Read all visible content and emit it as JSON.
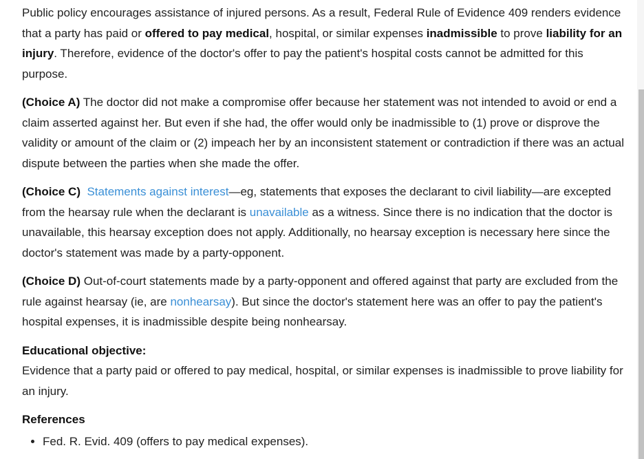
{
  "intro": {
    "t1": "Public policy encourages assistance of injured persons.  As a result, Federal Rule of Evidence 409 renders evidence that a party has paid or ",
    "b1": "offered to pay medical",
    "t2": ", hospital, or similar expenses ",
    "b2": "inadmissible",
    "t3": " to prove ",
    "b3": "liability for an injury",
    "t4": ".  Therefore, evidence of the doctor's offer to pay the patient's hospital costs cannot be admitted for this purpose."
  },
  "choice_a": {
    "label": "(Choice A)",
    "text": "  The doctor did not make a compromise offer because her statement was not intended to avoid or end a claim asserted against her.  But even if she had, the offer would only be inadmissible to (1) prove or disprove the validity or amount of the claim or (2) impeach her by an inconsistent statement or contradiction if there was an actual dispute between the parties when she made the offer."
  },
  "choice_c": {
    "label": "(Choice C)",
    "link1": "Statements against interest",
    "t1": "—eg, statements that exposes the declarant to civil liability—are excepted from the hearsay rule when the declarant is ",
    "link2": "unavailable",
    "t2": " as a witness.  Since there is no indication that the doctor is unavailable, this hearsay exception does not apply.  Additionally, no hearsay exception is necessary here since the doctor's statement was made by a party-opponent."
  },
  "choice_d": {
    "label": "(Choice D)",
    "t1": "  Out-of-court statements made by a party-opponent and offered against that party are excluded from the rule against hearsay (ie, are ",
    "link1": "nonhearsay",
    "t2": ").  But since the doctor's statement here was an offer to pay the patient's hospital expenses, it is inadmissible despite being nonhearsay."
  },
  "objective": {
    "heading": "Educational objective:",
    "text": "Evidence that a party paid or offered to pay medical, hospital, or similar expenses is inadmissible to prove liability for an injury."
  },
  "references": {
    "heading": "References",
    "items": [
      "Fed. R. Evid. 409 (offers to pay medical expenses)."
    ]
  },
  "colors": {
    "link": "#3a8fd6",
    "text": "#222222",
    "scrollbar_thumb": "#c1c1c1"
  }
}
